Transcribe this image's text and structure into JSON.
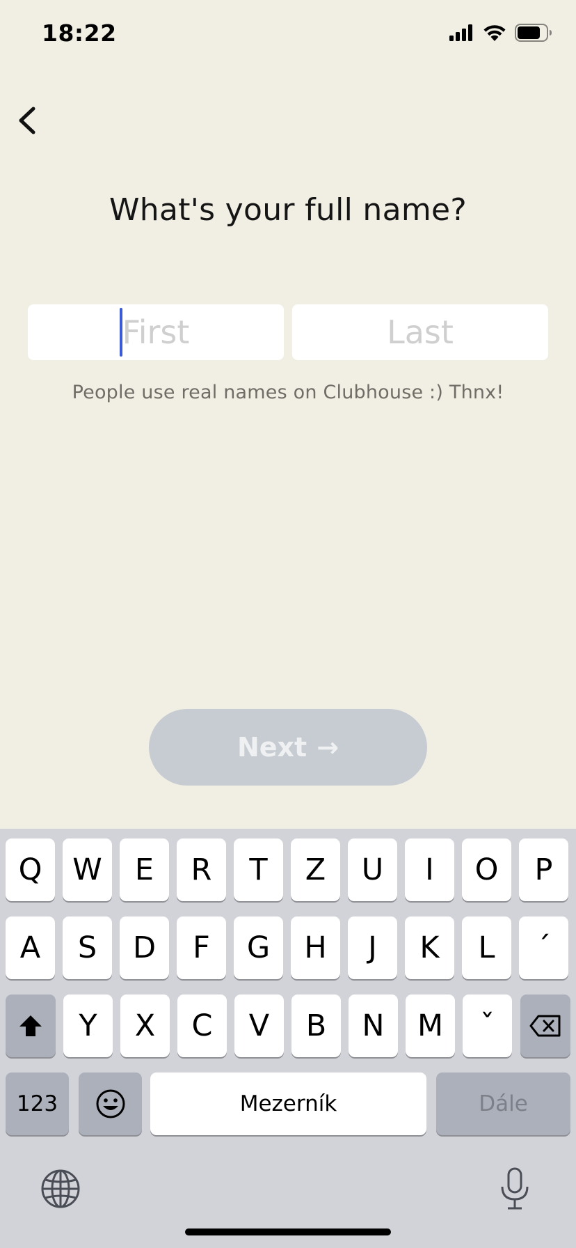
{
  "status_bar": {
    "time": "18:22",
    "battery_level": 0.8
  },
  "header": {
    "title": "What's your full name?"
  },
  "form": {
    "first_placeholder": "First",
    "last_placeholder": "Last",
    "first_value": "",
    "last_value": "",
    "hint": "People use real names on Clubhouse :) Thnx!"
  },
  "next_button": {
    "label": "Next",
    "arrow": "→"
  },
  "keyboard": {
    "row1": [
      "Q",
      "W",
      "E",
      "R",
      "T",
      "Z",
      "U",
      "I",
      "O",
      "P"
    ],
    "row2": [
      "A",
      "S",
      "D",
      "F",
      "G",
      "H",
      "J",
      "K",
      "L",
      "´"
    ],
    "row3": [
      "Y",
      "X",
      "C",
      "V",
      "B",
      "N",
      "M",
      "ˇ"
    ],
    "numbers_label": "123",
    "space_label": "Mezerník",
    "return_label": "Dále"
  },
  "colors": {
    "background": "#f1efe4",
    "caret": "#3b5bd6",
    "next_button_disabled": "#c7ccd3",
    "keyboard_bg": "#d1d3d9"
  }
}
